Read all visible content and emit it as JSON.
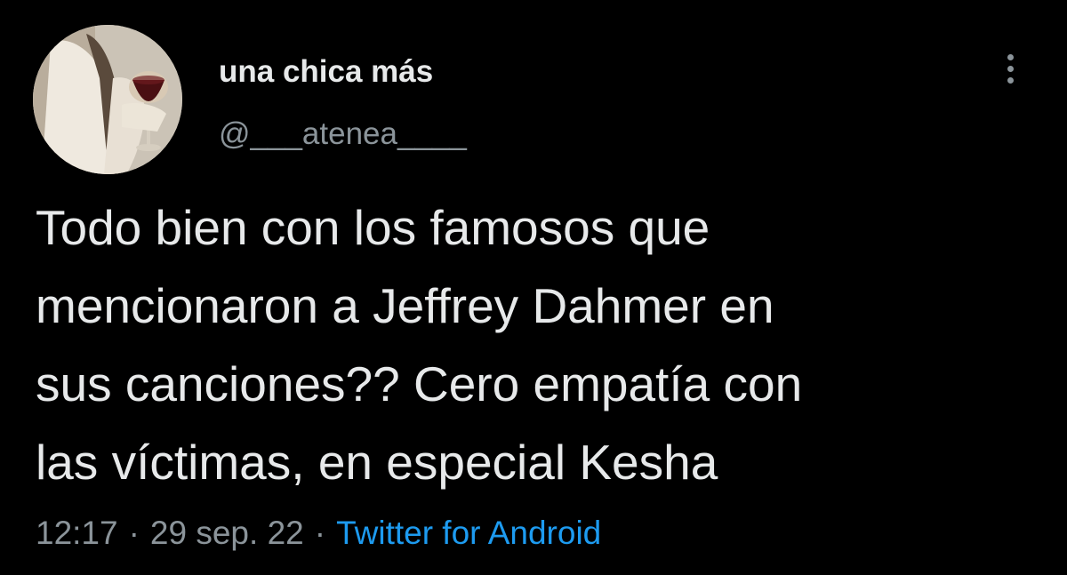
{
  "tweet": {
    "author": {
      "display_name": "una chica más",
      "handle": "@___atenea____"
    },
    "text": "Todo bien con los famosos que\nmencionaron a Jeffrey Dahmer en\nsus canciones?? Cero empatía con\nlas víctimas, en especial Kesha",
    "time": "12:17",
    "separator": "·",
    "date": "29 sep. 22",
    "source": "Twitter for Android"
  },
  "icons": {
    "more_menu": "more-vertical-icon",
    "avatar": "profile-photo"
  },
  "colors": {
    "background": "#000000",
    "primary_text": "#e7e9ea",
    "secondary_text": "#8b949a",
    "link": "#1d9bf0"
  }
}
